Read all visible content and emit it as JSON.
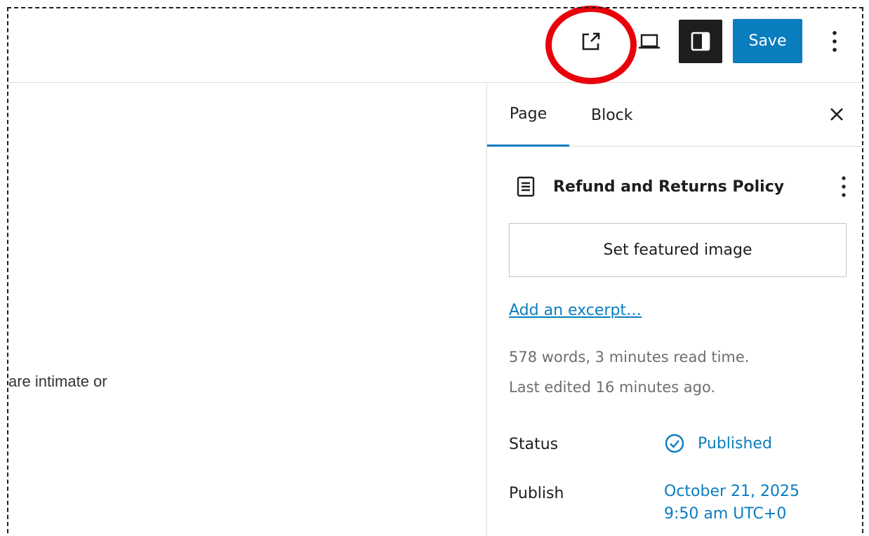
{
  "header": {
    "external_icon": "external-link-icon",
    "preview_icon": "desktop-preview-icon",
    "settings_icon": "sidebar-settings-icon",
    "save_label": "Save",
    "options_icon": "vertical-ellipsis-icon"
  },
  "canvas": {
    "visible_text": "are intimate or"
  },
  "sidebar": {
    "tabs": [
      {
        "label": "Page",
        "active": true
      },
      {
        "label": "Block",
        "active": false
      }
    ],
    "close_icon": "close-icon",
    "post": {
      "icon": "page-icon",
      "title": "Refund and Returns Policy",
      "menu_icon": "vertical-ellipsis-icon"
    },
    "featured_image_label": "Set featured image",
    "excerpt_link": "Add an excerpt…",
    "word_count_text": "578 words, 3 minutes read time.",
    "last_edited_text": "Last edited 16 minutes ago.",
    "status": {
      "label": "Status",
      "value": "Published",
      "icon": "check-circle-icon"
    },
    "publish": {
      "label": "Publish",
      "date": "October 21, 2025",
      "time": "9:50 am UTC+0"
    }
  },
  "colors": {
    "accent": "#0a7dbf",
    "highlight": "#e8000b",
    "dark": "#1e1e1e",
    "muted": "#6e6e6e"
  }
}
